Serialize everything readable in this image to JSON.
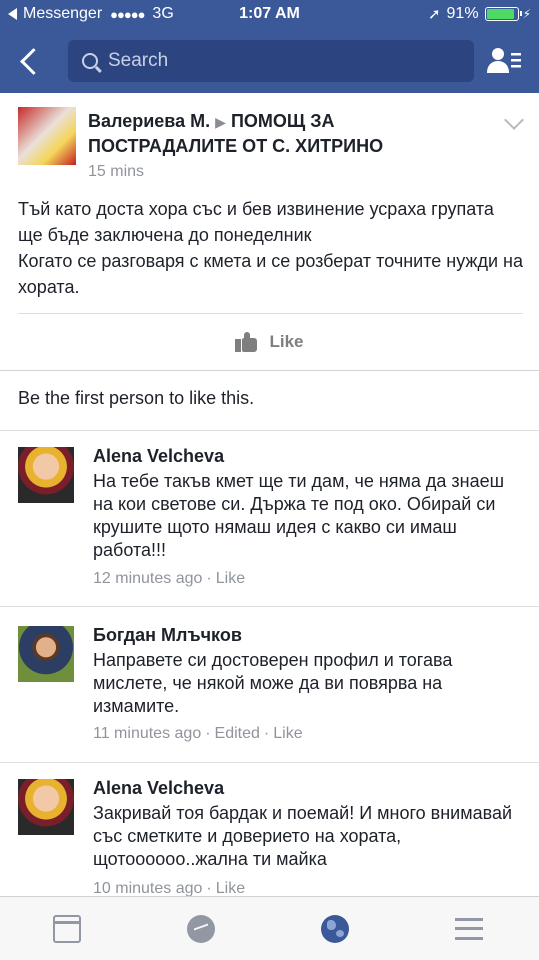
{
  "status_bar": {
    "carrier": "Messenger",
    "signal": "●●●●●",
    "network": "3G",
    "time": "1:07 AM",
    "location_icon": "➚",
    "battery": "91%",
    "battery_level": 0.91,
    "charging_icon": "⚡"
  },
  "nav": {
    "search_placeholder": "Search"
  },
  "post": {
    "author": "Валериева М.",
    "arrow": "▶",
    "group": "ПОМОЩ ЗА ПОСТРАДАЛИТЕ ОТ С. ХИТРИНО",
    "time": "15 mins",
    "text": "Тъй като доста хора със и бев извинение усраха групата ще бъде заключена до понеделник\nКогато се разговаря с кмета и се розберат точните нужди на хората.",
    "like_label": "Like",
    "like_summary": "Be the first person to like this."
  },
  "comments": [
    {
      "name": "Alena Velcheva",
      "text": "На тебе такъв кмет ще ти дам, че няма да знаеш на кои светове си. Държа те под око. Обирай си крушите щото нямаш идея с какво си имаш работа!!!",
      "time": "12 minutes ago",
      "edited": "",
      "like": "Like"
    },
    {
      "name": "Богдан Млъчков",
      "text": "Направете си достоверен профил и тогава мислете, че някой може да ви повярва на измамите.",
      "time": "11 minutes ago",
      "edited": "Edited",
      "like": "Like"
    },
    {
      "name": "Alena Velcheva",
      "text": "Закривай тоя бардак и поемай! И много внимавай със сметките и доверието на хората, щотоооооо..жална ти майка",
      "time": "10 minutes ago",
      "edited": "",
      "like": "Like"
    }
  ],
  "colors": {
    "brand": "#3b5998",
    "meta_text": "#90949c"
  }
}
